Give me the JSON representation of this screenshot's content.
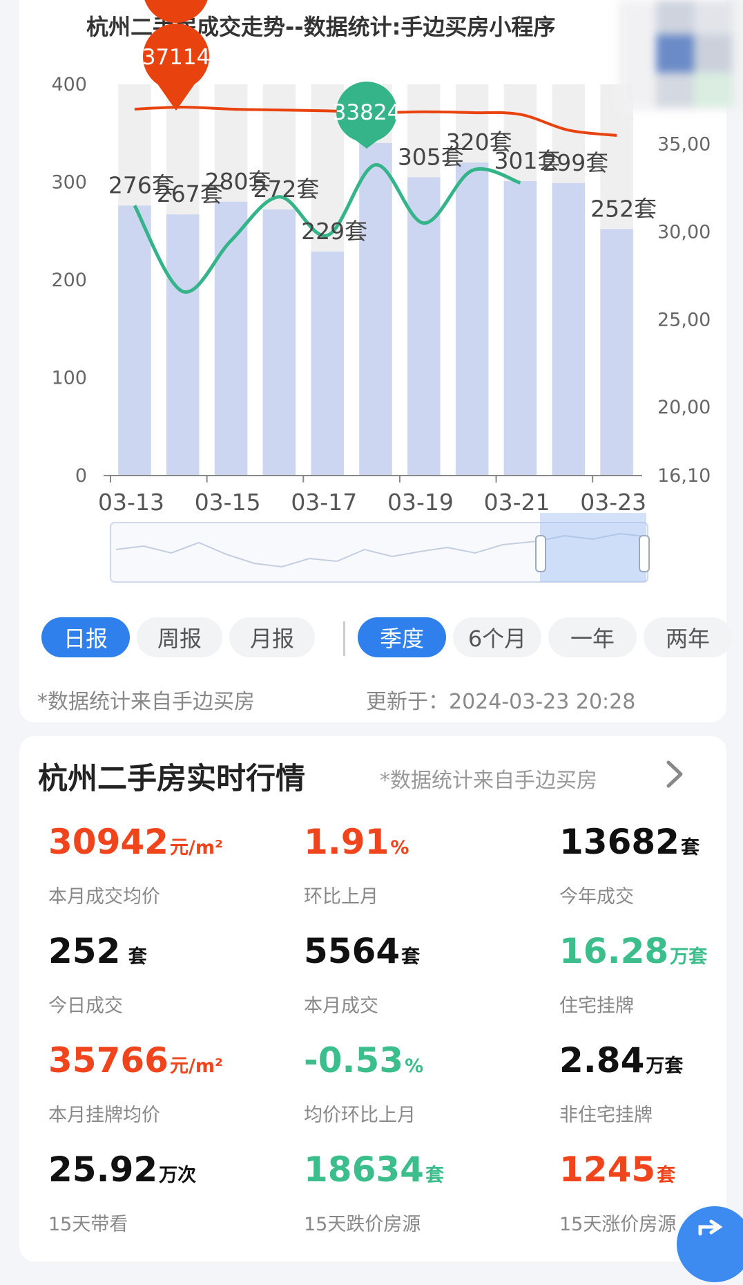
{
  "chart": {
    "title": "杭州二手房成交走势--数据统计:手边买房小程序",
    "left_axis_ticks": [
      "400",
      "300",
      "200",
      "100",
      "0"
    ],
    "right_axis_ticks": [
      "35,00",
      "30,00",
      "25,00",
      "20,00",
      "16,10"
    ],
    "x_ticks": [
      "03-13",
      "03-15",
      "03-17",
      "03-19",
      "03-21",
      "03-23"
    ],
    "markers": {
      "max_price": "37114",
      "min_price": "33824"
    },
    "colors": {
      "bar": "#cdd6f0",
      "bar_bg": "#efefef",
      "price_line": "#e8430e",
      "volume_line": "#35b48a",
      "accent": "#2f80ed"
    }
  },
  "chart_data": {
    "type": "bar",
    "categories": [
      "03-13",
      "03-14",
      "03-15",
      "03-16",
      "03-17",
      "03-18",
      "03-19",
      "03-20",
      "03-21",
      "03-22",
      "03-23"
    ],
    "series": [
      {
        "values": [
          276,
          267,
          280,
          272,
          229,
          340,
          305,
          320,
          301,
          299,
          252
        ],
        "labels": [
          "276套",
          "267套",
          "280套",
          "272套",
          "229套",
          "",
          "305套",
          "320套",
          "301套",
          "299套",
          "252套"
        ]
      },
      {
        "values": [
          37000,
          37114,
          37000,
          36950,
          36900,
          36800,
          36850,
          36800,
          36700,
          35800,
          35500
        ]
      },
      {
        "values": [
          31500,
          26600,
          29500,
          32000,
          29800,
          33824,
          30500,
          33500,
          32800
        ]
      }
    ],
    "ylim_left": [
      0,
      400
    ],
    "ylim_right": [
      16100,
      37114
    ],
    "x_window": [
      "03-13",
      "03-23"
    ]
  },
  "period_tabs": [
    "日报",
    "周报",
    "月报",
    "季度",
    "6个月",
    "一年",
    "两年"
  ],
  "chart_footer": {
    "source": "*数据统计来自手边买房",
    "updated": "更新于：2024-03-23 20:28"
  },
  "market": {
    "title": "杭州二手房实时行情",
    "source": "*数据统计来自手边买房",
    "stats": [
      {
        "value": "30942",
        "unit": "元/m²",
        "label": "本月成交均价"
      },
      {
        "value": "1.91",
        "unit": "%",
        "label": "环比上月"
      },
      {
        "value": "13682",
        "unit": "套",
        "label": "今年成交"
      },
      {
        "value": "252",
        "unit": " 套",
        "label": "今日成交"
      },
      {
        "value": "5564",
        "unit": "套",
        "label": "本月成交"
      },
      {
        "value": "16.28",
        "unit": "万套",
        "label": "住宅挂牌"
      },
      {
        "value": "35766",
        "unit": "元/m²",
        "label": "本月挂牌均价"
      },
      {
        "value": "-0.53",
        "unit": "%",
        "label": "均价环比上月"
      },
      {
        "value": "2.84",
        "unit": "万套",
        "label": "非住宅挂牌"
      },
      {
        "value": "25.92",
        "unit": "万次",
        "label": "15天带看"
      },
      {
        "value": "18634",
        "unit": "套",
        "label": "15天跌价房源"
      },
      {
        "value": "1245",
        "unit": "套",
        "label": "15天涨价房源"
      }
    ],
    "value_colors": [
      "red",
      "red",
      "black",
      "black",
      "black",
      "green",
      "red",
      "green",
      "black",
      "black",
      "green",
      "red"
    ]
  }
}
